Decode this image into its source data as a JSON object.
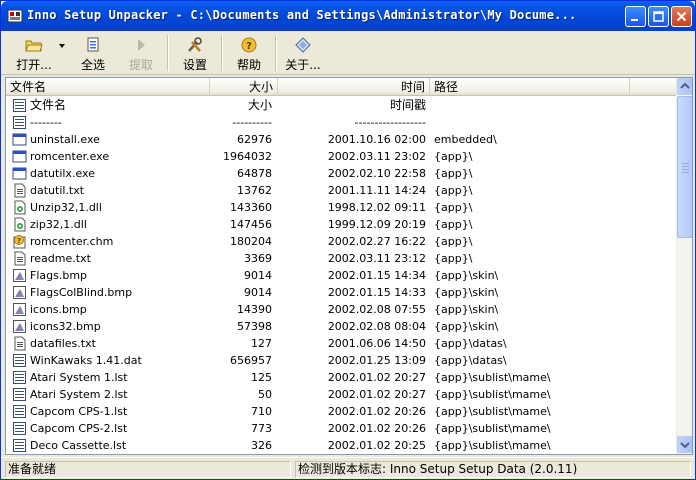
{
  "window": {
    "title": "Inno Setup Unpacker - C:\\Documents and Settings\\Administrator\\My Docume..."
  },
  "toolbar": {
    "open_label": "打开...",
    "select_all_label": "全选",
    "extract_label": "提取",
    "settings_label": "设置",
    "help_label": "帮助",
    "about_label": "关于..."
  },
  "columns": {
    "name": "文件名",
    "size": "大小",
    "time": "时间",
    "path": "路径"
  },
  "list_header_row": {
    "name": "文件名",
    "size": "大小",
    "time": "时间戳",
    "name_rule": "--------",
    "size_rule": "----------",
    "time_rule": "------------------"
  },
  "files": [
    {
      "name": "uninstall.exe",
      "size": "62976",
      "time": "2001.10.16 02:00",
      "path": "embedded\\",
      "icon": "exe-icon"
    },
    {
      "name": "romcenter.exe",
      "size": "1964032",
      "time": "2002.03.11 23:02",
      "path": "{app}\\",
      "icon": "exe-icon"
    },
    {
      "name": "datutilx.exe",
      "size": "64878",
      "time": "2002.02.10 22:58",
      "path": "{app}\\",
      "icon": "exe-icon"
    },
    {
      "name": "datutil.txt",
      "size": "13762",
      "time": "2001.11.11 14:24",
      "path": "{app}\\",
      "icon": "text-icon"
    },
    {
      "name": "Unzip32,1.dll",
      "size": "143360",
      "time": "1998.12.02 09:11",
      "path": "{app}\\",
      "icon": "dll-icon"
    },
    {
      "name": "zip32,1.dll",
      "size": "147456",
      "time": "1999.12.09 20:19",
      "path": "{app}\\",
      "icon": "dll-icon"
    },
    {
      "name": "romcenter.chm",
      "size": "180204",
      "time": "2002.02.27 16:22",
      "path": "{app}\\",
      "icon": "help-file-icon"
    },
    {
      "name": "readme.txt",
      "size": "3369",
      "time": "2002.03.11 23:12",
      "path": "{app}\\",
      "icon": "text-icon"
    },
    {
      "name": "Flags.bmp",
      "size": "9014",
      "time": "2002.01.15 14:34",
      "path": "{app}\\skin\\",
      "icon": "bitmap-icon"
    },
    {
      "name": "FlagsColBlind.bmp",
      "size": "9014",
      "time": "2002.01.15 14:33",
      "path": "{app}\\skin\\",
      "icon": "bitmap-icon"
    },
    {
      "name": "icons.bmp",
      "size": "14390",
      "time": "2002.02.08 07:55",
      "path": "{app}\\skin\\",
      "icon": "bitmap-icon"
    },
    {
      "name": "icons32.bmp",
      "size": "57398",
      "time": "2002.02.08 08:04",
      "path": "{app}\\skin\\",
      "icon": "bitmap-icon"
    },
    {
      "name": "datafiles.txt",
      "size": "127",
      "time": "2001.06.06 14:50",
      "path": "{app}\\datas\\",
      "icon": "text-icon"
    },
    {
      "name": "WinKawaks 1.41.dat",
      "size": "656957",
      "time": "2002.01.25 13:09",
      "path": "{app}\\datas\\",
      "icon": "dat-icon"
    },
    {
      "name": "Atari System 1.lst",
      "size": "125",
      "time": "2002.01.02 20:27",
      "path": "{app}\\sublist\\mame\\",
      "icon": "list-icon"
    },
    {
      "name": "Atari System 2.lst",
      "size": "50",
      "time": "2002.01.02 20:27",
      "path": "{app}\\sublist\\mame\\",
      "icon": "list-icon"
    },
    {
      "name": "Capcom CPS-1.lst",
      "size": "710",
      "time": "2002.01.02 20:26",
      "path": "{app}\\sublist\\mame\\",
      "icon": "list-icon"
    },
    {
      "name": "Capcom CPS-2.lst",
      "size": "773",
      "time": "2002.01.02 20:26",
      "path": "{app}\\sublist\\mame\\",
      "icon": "list-icon"
    },
    {
      "name": "Deco Cassette.lst",
      "size": "326",
      "time": "2002.01.02 20:25",
      "path": "{app}\\sublist\\mame\\",
      "icon": "list-icon"
    }
  ],
  "status": {
    "left": "准备就绪",
    "right": "检测到版本标志: Inno Setup Setup Data (2.0.11)"
  },
  "colors": {
    "titlebar": "#0a5ff5",
    "window_bg": "#ece9d8",
    "list_border": "#7f9db9"
  }
}
